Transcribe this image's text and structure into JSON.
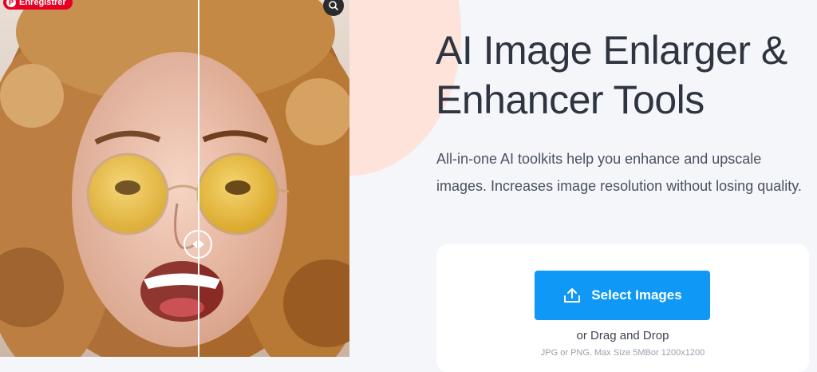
{
  "pinterest": {
    "label": "Enregistrer",
    "glyph": "P"
  },
  "hero": {
    "title": "AI Image Enlarger & Enhancer Tools",
    "subtitle": "All-in-one AI toolkits help you enhance and upscale images. Increases image resolution without losing quality."
  },
  "upload": {
    "button_label": "Select Images",
    "drag_text": "or Drag and Drop",
    "formats_text": "JPG or PNG. Max Size 5MBor 1200x1200"
  },
  "colors": {
    "accent": "#1098f7",
    "title": "#2e3440",
    "pinterest": "#e60023",
    "peach": "#fde3da"
  }
}
